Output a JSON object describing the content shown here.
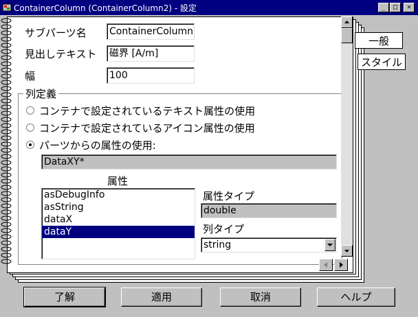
{
  "window": {
    "title": "ContainerColumn (ContainerColumn2) - 設定",
    "minimize": "_",
    "maximize": "□",
    "close": "✕"
  },
  "tabs": [
    {
      "label": "一般",
      "active": true
    },
    {
      "label": "スタイル",
      "active": false
    }
  ],
  "form": {
    "subparts_label": "サブパーツ名",
    "subparts_value": "ContainerColumn",
    "heading_label": "見出しテキスト",
    "heading_value": "磁界 [A/m]",
    "width_label": "幅",
    "width_value": "100"
  },
  "column_def": {
    "group_title": "列定義",
    "options": [
      {
        "label": "コンテナで設定されているテキスト属性の使用",
        "selected": false
      },
      {
        "label": "コンテナで設定されているアイコン属性の使用",
        "selected": false
      },
      {
        "label": "パーツからの属性の使用:",
        "selected": true
      }
    ],
    "parts_attr_value": "DataXY*",
    "attr_list_label": "属性",
    "attr_items": [
      "asDebugInfo",
      "asString",
      "dataX",
      "dataY"
    ],
    "attr_selected": "dataY",
    "attr_type_label": "属性タイプ",
    "attr_type_value": "double",
    "col_type_label": "列タイプ",
    "col_type_value": "string"
  },
  "buttons": {
    "ok": "了解",
    "apply": "適用",
    "cancel": "取消",
    "help": "ヘルプ"
  },
  "colors": {
    "titlebar": "#000080",
    "dialog_bg": "#c0c0c0",
    "selection": "#000080"
  }
}
